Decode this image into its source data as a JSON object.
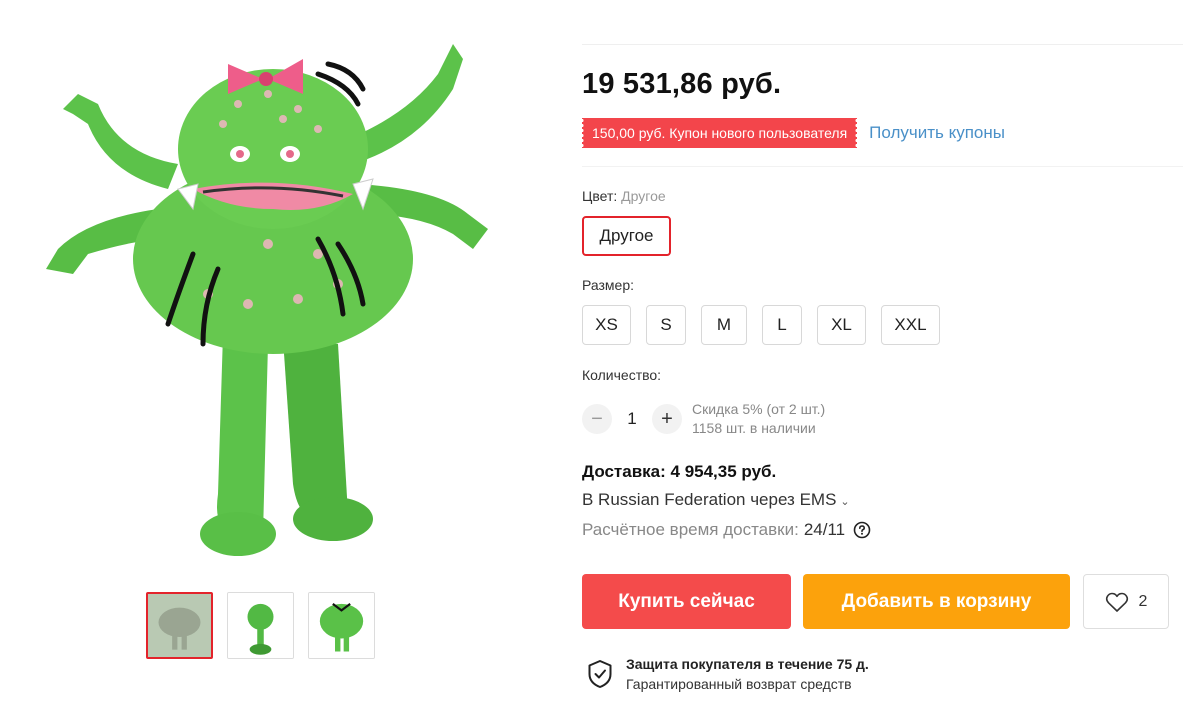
{
  "product": {
    "price": "19 531,86 руб.",
    "coupon": {
      "text": "150,00 руб. Купон нового пользователя",
      "link": "Получить купоны"
    },
    "color": {
      "label": "Цвет:",
      "selected": "Другое",
      "options": [
        "Другое"
      ]
    },
    "size": {
      "label": "Размер:",
      "options": [
        "XS",
        "S",
        "M",
        "L",
        "XL",
        "XXL"
      ]
    },
    "quantity": {
      "label": "Количество:",
      "value": "1",
      "minus": "−",
      "plus": "+",
      "discount": "Скидка 5% (от 2 шт.)",
      "stock": "1158 шт. в наличии"
    },
    "delivery": {
      "title": "Доставка: 4 954,35 руб.",
      "route": "В Russian Federation через EMS",
      "time_label": "Расчётное время доставки:",
      "time_value": "24/11"
    },
    "actions": {
      "buy": "Купить сейчас",
      "cart": "Добавить в корзину",
      "wishlist_count": "2"
    },
    "protection": {
      "title": "Защита покупателя в течение 75 д.",
      "subtitle": "Гарантированный возврат средств"
    }
  },
  "gallery": {
    "thumbnails": 3,
    "active_index": 0
  },
  "colors": {
    "accent_red": "#f44b4b",
    "coupon_red": "#f3454b",
    "cart_orange": "#fca20c",
    "link_blue": "#4a90c8",
    "selected_border": "#e3232b"
  },
  "icons": {
    "wishlist": "heart-icon",
    "help": "question-circle-icon",
    "protection": "shield-check-icon",
    "route_dropdown": "chevron-down-icon"
  }
}
